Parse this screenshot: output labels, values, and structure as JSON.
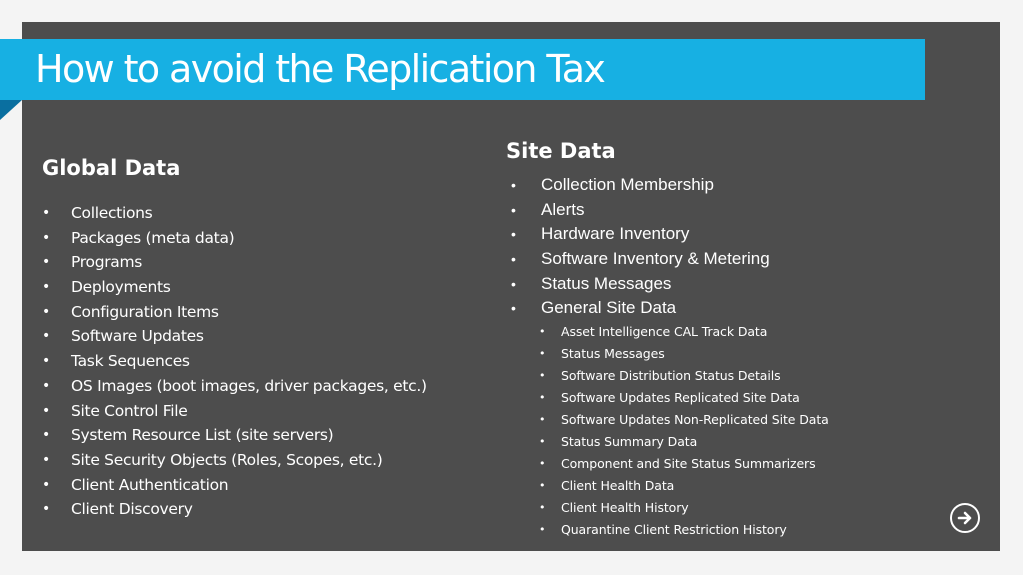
{
  "slide": {
    "title": "How to avoid the Replication Tax",
    "global_data": {
      "heading": "Global Data",
      "items": [
        "Collections",
        "Packages (meta data)",
        "Programs",
        "Deployments",
        "Configuration Items",
        "Software Updates",
        "Task Sequences",
        "OS Images (boot images, driver packages, etc.)",
        "Site Control File",
        "System Resource List (site servers)",
        "Site Security Objects (Roles, Scopes, etc.)",
        "Client Authentication",
        "Client Discovery"
      ]
    },
    "site_data": {
      "heading": "Site Data",
      "items": [
        "Collection Membership",
        "Alerts",
        "Hardware Inventory",
        "Software Inventory & Metering",
        "Status Messages",
        "General Site Data"
      ],
      "general_site_data_subitems": [
        "Asset Intelligence CAL Track Data",
        "Status Messages",
        "Software Distribution Status Details",
        "Software Updates Replicated Site Data",
        "Software Updates Non-Replicated Site Data",
        "Status Summary Data",
        "Component and Site Status Summarizers",
        "Client Health Data",
        "Client Health History",
        "Quarantine Client Restriction History"
      ]
    },
    "bullet_glyph": "•",
    "next_icon": "arrow-right-circle-icon",
    "colors": {
      "background": "#4d4d4d",
      "title_bar": "#17b0e3",
      "title_fold": "#0a6fa0",
      "text": "#ffffff"
    }
  }
}
